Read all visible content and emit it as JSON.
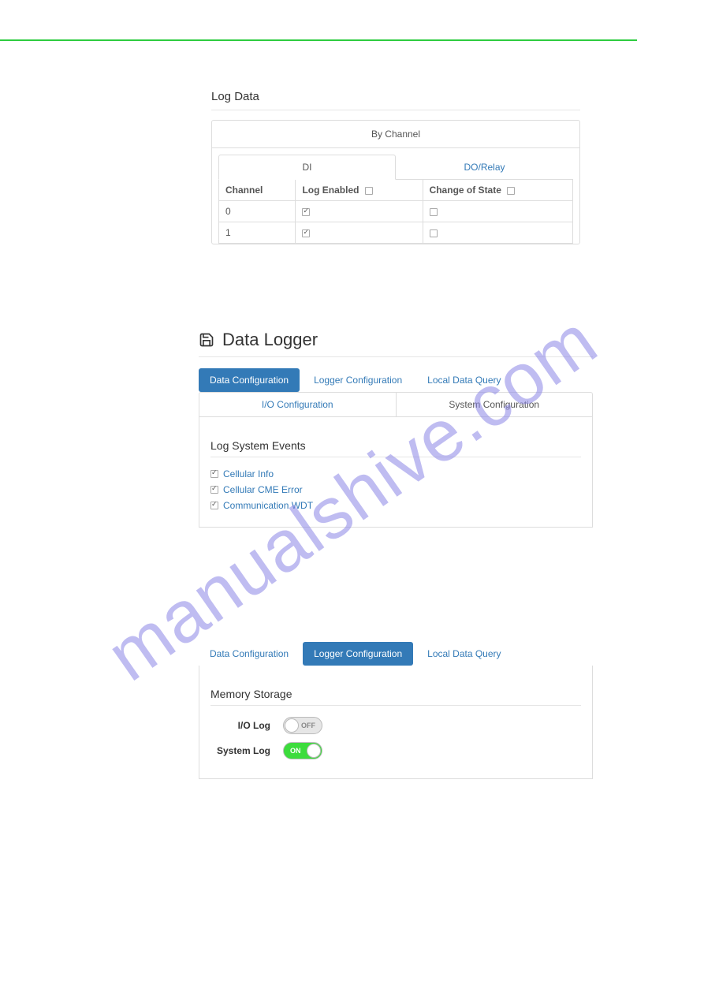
{
  "watermark": "manualshive.com",
  "log_data": {
    "title": "Log Data",
    "panel_header": "By Channel",
    "tabs": {
      "di": "DI",
      "do": "DO/Relay"
    },
    "columns": {
      "channel": "Channel",
      "log_enabled": "Log Enabled",
      "change_of_state": "Change of State"
    },
    "rows": [
      {
        "channel": "0",
        "log_enabled": true,
        "change_of_state": false
      },
      {
        "channel": "1",
        "log_enabled": true,
        "change_of_state": false
      }
    ]
  },
  "data_logger": {
    "title": "Data Logger",
    "tabs": {
      "data_config": "Data Configuration",
      "logger_config": "Logger Configuration",
      "local_query": "Local Data Query"
    },
    "sub_tabs": {
      "io_config": "I/O Configuration",
      "sys_config": "System Configuration"
    },
    "log_sys_events": {
      "title": "Log System Events",
      "items": [
        {
          "label": "Cellular Info",
          "checked": true
        },
        {
          "label": "Cellular CME Error",
          "checked": true
        },
        {
          "label": "Communication WDT",
          "checked": true
        }
      ]
    }
  },
  "memory_storage": {
    "title": "Memory Storage",
    "io_log_label": "I/O Log",
    "system_log_label": "System Log",
    "io_log_state": "OFF",
    "system_log_state": "ON"
  }
}
